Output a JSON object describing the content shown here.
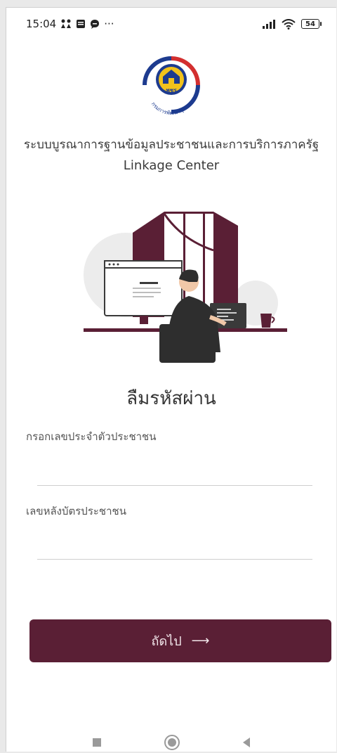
{
  "status_bar": {
    "time": "15:04",
    "more_indicator": "···",
    "battery_level": "54",
    "icons": [
      "people-icon",
      "message-icon",
      "chat-icon",
      "signal-icon",
      "wifi-icon",
      "battery-icon"
    ]
  },
  "logo": {
    "arc_text": "กรมการพัฒนาชุมชน",
    "emblem_text": "พชร"
  },
  "app": {
    "title": "ระบบบูรณาการฐานข้อมูลประชาชนและการบริการภาครัฐ",
    "subtitle": "Linkage Center"
  },
  "page": {
    "title": "ลืมรหัสผ่าน"
  },
  "form": {
    "id_label": "กรอกเลขประจำตัวประชาชน",
    "id_value": "",
    "back_card_label": "เลขหลังบัตรประชาชน",
    "back_card_value": ""
  },
  "actions": {
    "next_label": "ถัดไป",
    "next_arrow": "⟶"
  },
  "nav_bar": {
    "items": [
      "recents-button",
      "home-button",
      "back-button"
    ]
  },
  "colors": {
    "accent": "#5a1f35",
    "button_text": "#f3e8ec",
    "label_text": "#555555",
    "divider": "#cfcfcf"
  }
}
